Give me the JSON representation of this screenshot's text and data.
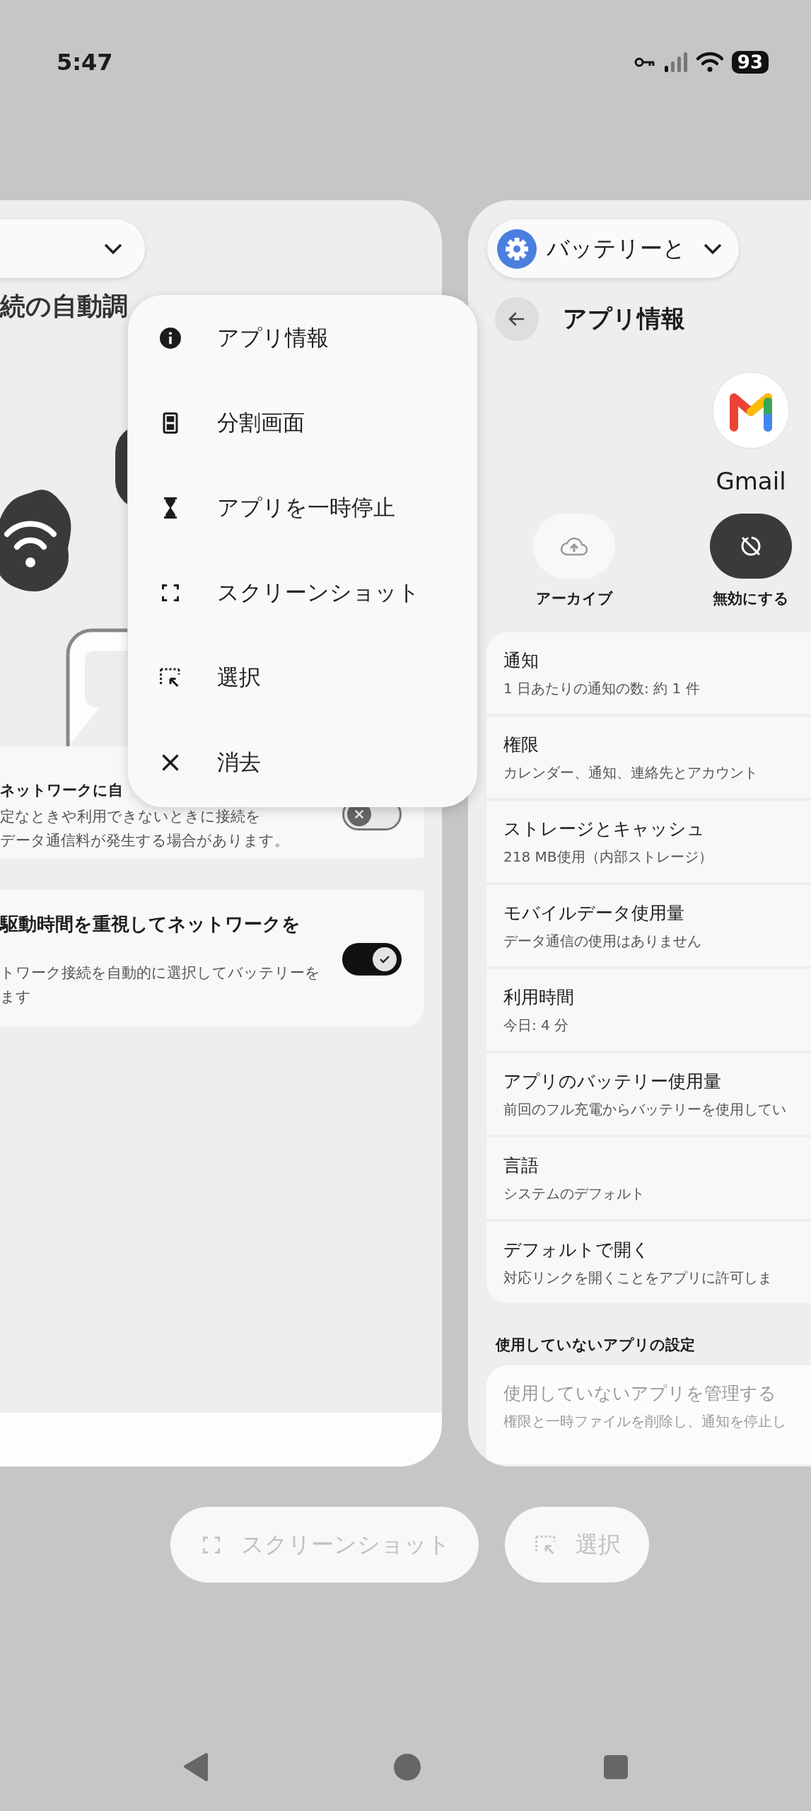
{
  "status_bar": {
    "time": "5:47",
    "battery": "93"
  },
  "left_card": {
    "title": "続の自動調",
    "settings": [
      {
        "title": "ネットワークに自",
        "lines": [
          "定なときや利用できないときに接続を",
          "データ通信料が発生する場合があります。"
        ],
        "on": false
      },
      {
        "title": "駆動時間を重視してネットワークを",
        "lines": [
          "トワーク接続を自動的に選択してバッテリーを",
          "ます"
        ],
        "on": true
      }
    ]
  },
  "menu": {
    "items": [
      {
        "label": "アプリ情報",
        "kind": "info"
      },
      {
        "label": "分割画面",
        "kind": "split"
      },
      {
        "label": "アプリを一時停止",
        "kind": "pause"
      },
      {
        "label": "スクリーンショット",
        "kind": "screenshot"
      },
      {
        "label": "選択",
        "kind": "select"
      },
      {
        "label": "消去",
        "kind": "close"
      }
    ]
  },
  "right_card": {
    "header": "バッテリーと",
    "title": "アプリ情報",
    "app_name": "Gmail",
    "app_actions": [
      {
        "label": "アーカイブ",
        "kind": "archive"
      },
      {
        "label": "無効にする",
        "kind": "disable"
      }
    ],
    "items": [
      {
        "title": "通知",
        "subtitle": "1 日あたりの通知の数: 約 1 件"
      },
      {
        "title": "権限",
        "subtitle": "カレンダー、通知、連絡先とアカウント"
      },
      {
        "title": "ストレージとキャッシュ",
        "subtitle": "218 MB使用（内部ストレージ）"
      },
      {
        "title": "モバイルデータ使用量",
        "subtitle": "データ通信の使用はありません"
      },
      {
        "title": "利用時間",
        "subtitle": "今日: 4 分"
      },
      {
        "title": "アプリのバッテリー使用量",
        "subtitle": "前回のフル充電からバッテリーを使用してい"
      },
      {
        "title": "言語",
        "subtitle": "システムのデフォルト"
      },
      {
        "title": "デフォルトで開く",
        "subtitle": "対応リンクを開くことをアプリに許可しま"
      }
    ],
    "section_title": "使用していないアプリの設定",
    "faded_item": {
      "title": "使用していないアプリを管理する",
      "subtitle": "権限と一時ファイルを削除し、通知を停止し"
    }
  },
  "actions": [
    {
      "label": "スクリーンショット",
      "kind": "screenshot"
    },
    {
      "label": "選択",
      "kind": "select"
    }
  ]
}
